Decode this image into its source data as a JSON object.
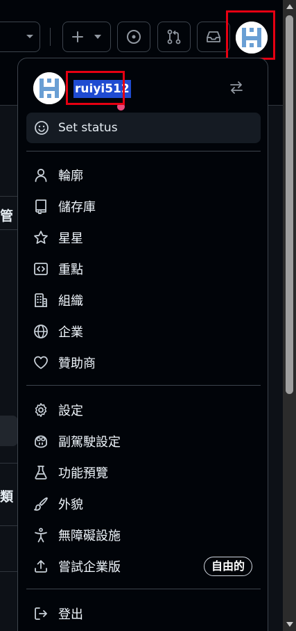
{
  "user": {
    "username": "ruiyi512"
  },
  "menu": {
    "set_status": "Set status",
    "group1": [
      {
        "label": "輪廓",
        "icon": "person-icon"
      },
      {
        "label": "儲存庫",
        "icon": "repo-icon"
      },
      {
        "label": "星星",
        "icon": "star-icon"
      },
      {
        "label": "重點",
        "icon": "code-square-icon"
      },
      {
        "label": "組織",
        "icon": "organization-icon"
      },
      {
        "label": "企業",
        "icon": "globe-icon"
      },
      {
        "label": "贊助商",
        "icon": "heart-icon"
      }
    ],
    "group2": [
      {
        "label": "設定",
        "icon": "gear-icon"
      },
      {
        "label": "副駕駛設定",
        "icon": "copilot-icon"
      },
      {
        "label": "功能預覽",
        "icon": "beaker-icon"
      },
      {
        "label": "外貌",
        "icon": "paintbrush-icon"
      },
      {
        "label": "無障礙設施",
        "icon": "accessibility-icon"
      },
      {
        "label": "嘗試企業版",
        "icon": "upload-icon",
        "badge": "自由的"
      }
    ],
    "sign_out": "登出"
  },
  "background": {
    "partial_text_1": "管",
    "partial_text_2": "類"
  },
  "colors": {
    "highlight": "#e60012",
    "selection": "#1f4bd1",
    "status_dot": "#e8497a",
    "menu_bg": "#010409"
  }
}
